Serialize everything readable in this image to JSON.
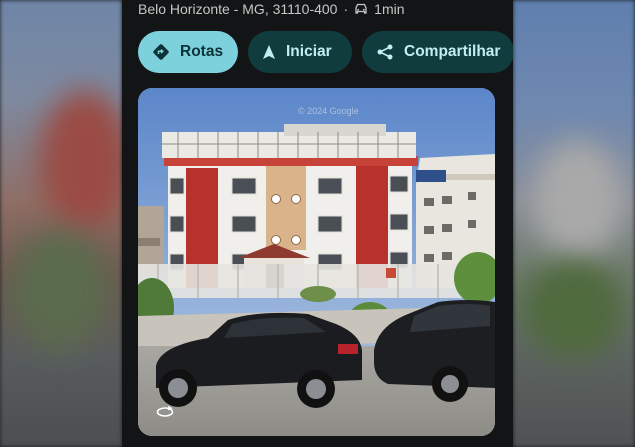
{
  "place": {
    "address": "Belo Horizonte - MG, 31110-400",
    "separator": "·",
    "travel_time": "1min",
    "travel_icon": "car-icon"
  },
  "actions": {
    "directions_label": "Rotas",
    "start_label": "Iniciar",
    "share_label": "Compartilhar"
  },
  "colors": {
    "primary_chip": "#7dd1dd",
    "secondary_chip": "#113c3d",
    "panel_bg": "#121416"
  },
  "photo": {
    "watermark": "© 2024 Google",
    "control_icon": "rotate-360-icon"
  }
}
